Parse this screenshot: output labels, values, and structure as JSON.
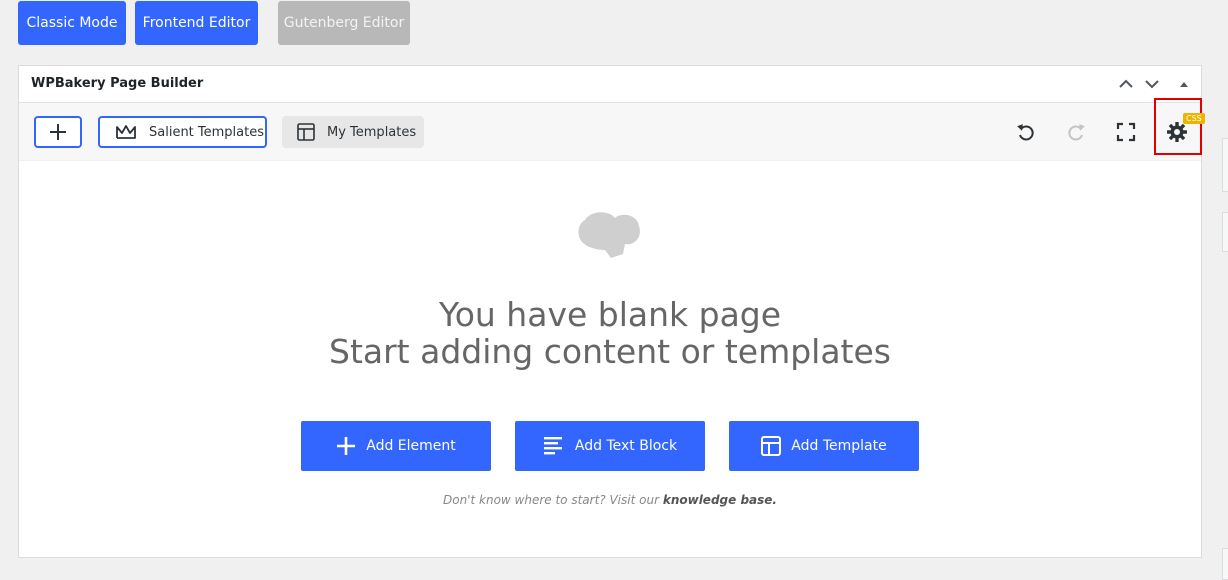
{
  "editor_modes": {
    "classic": "Classic Mode",
    "frontend": "Frontend Editor",
    "gutenberg": "Gutenberg Editor"
  },
  "panel": {
    "title": "WPBakery Page Builder"
  },
  "toolbar": {
    "salient_templates": "Salient Templates",
    "my_templates": "My Templates",
    "css_badge": "CSS"
  },
  "blank_page": {
    "line1": "You have blank page",
    "line2": "Start adding content or templates",
    "add_element": "Add Element",
    "add_text_block": "Add Text Block",
    "add_template": "Add Template",
    "help_prefix": "Don't know where to start? Visit our",
    "help_link": "knowledge base."
  },
  "colors": {
    "accent": "#3366ff",
    "disabled": "#b8b8b8",
    "highlight": "#e00000",
    "badge": "#f0b400"
  }
}
